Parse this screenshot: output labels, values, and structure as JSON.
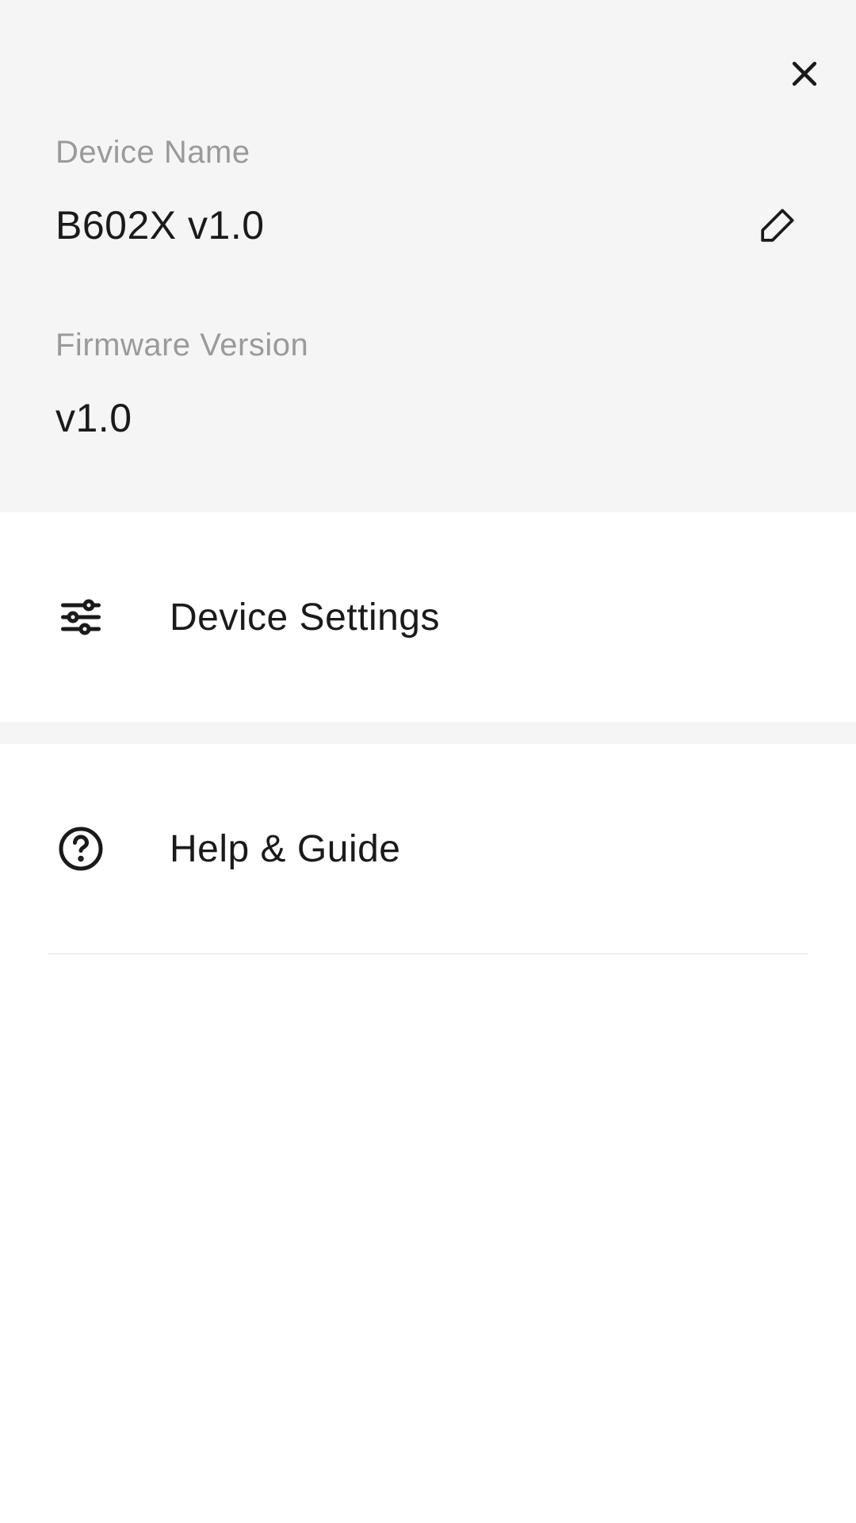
{
  "info": {
    "device_name_label": "Device Name",
    "device_name_value": "B602X v1.0",
    "firmware_label": "Firmware Version",
    "firmware_value": "v1.0"
  },
  "menu": {
    "device_settings": "Device Settings",
    "help_guide": "Help & Guide"
  }
}
